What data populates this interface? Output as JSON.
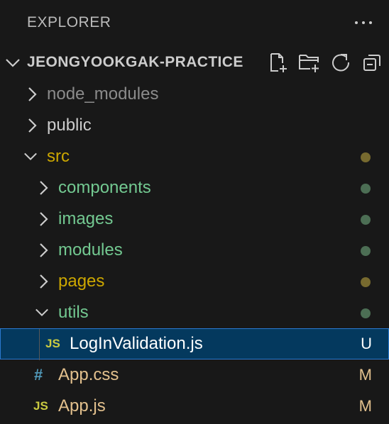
{
  "explorer": {
    "title": "EXPLORER"
  },
  "section": {
    "title": "JEONGYOOKGAK-PRACTICE",
    "actions": [
      "new-file-icon",
      "new-folder-icon",
      "refresh-icon",
      "collapse-all-icon"
    ]
  },
  "tree": {
    "node_modules": {
      "label": "node_modules",
      "color": "#8b8b8b"
    },
    "public": {
      "label": "public",
      "color": "#cccccc"
    },
    "src": {
      "label": "src",
      "color": "#cca700",
      "dot_color": "#776a2f"
    },
    "components": {
      "label": "components",
      "color": "#73c991",
      "dot_color": "#4c6e54"
    },
    "images": {
      "label": "images",
      "color": "#73c991",
      "dot_color": "#4c6e54"
    },
    "modules": {
      "label": "modules",
      "color": "#73c991",
      "dot_color": "#4c6e54"
    },
    "pages": {
      "label": "pages",
      "color": "#cca700",
      "dot_color": "#776a2f"
    },
    "utils": {
      "label": "utils",
      "color": "#73c991",
      "dot_color": "#4c6e54"
    },
    "login_validation": {
      "icon_text": "JS",
      "label": "LogInValidation.js",
      "badge": "U",
      "color": "#ffffff"
    },
    "app_css": {
      "icon_text": "#",
      "label": "App.css",
      "badge": "M",
      "color": "#e2c08d"
    },
    "app_js": {
      "icon_text": "JS",
      "label": "App.js",
      "badge": "M",
      "color": "#e2c08d"
    }
  },
  "colors": {
    "background": "#181818",
    "selection": "#04395e",
    "selection_border": "#2b79d0",
    "js_icon": "#cbcb41",
    "css_icon": "#519aba"
  }
}
